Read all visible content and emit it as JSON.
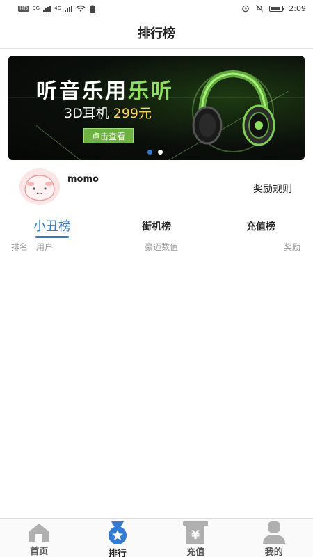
{
  "status_bar": {
    "time": "2:09",
    "net_1": "3G",
    "net_2": "4G",
    "hd": "HD"
  },
  "header": {
    "title": "排行榜"
  },
  "banner": {
    "headline_main": "听音乐用",
    "headline_highlight": "乐听",
    "subtitle": "3D耳机",
    "price": "299元",
    "button": "点击查看",
    "active_slide": 1,
    "slide_count": 2,
    "accent_color": "#8ee05a"
  },
  "user": {
    "name": "momo",
    "rules_link": "奖励规则"
  },
  "tabs": [
    {
      "label": "小丑榜",
      "active": true
    },
    {
      "label": "街机榜",
      "active": false
    },
    {
      "label": "充值榜",
      "active": false
    }
  ],
  "columns": {
    "rank": "排名",
    "user": "用户",
    "value": "豪迈数值",
    "reward": "奖励"
  },
  "bottom_nav": [
    {
      "label": "首页",
      "icon": "home-icon",
      "active": false
    },
    {
      "label": "排行",
      "icon": "medal-icon",
      "active": true
    },
    {
      "label": "充值",
      "icon": "yen-icon",
      "active": false
    },
    {
      "label": "我的",
      "icon": "person-icon",
      "active": false
    }
  ],
  "colors": {
    "accent": "#2f7bd6",
    "icon_gray": "#b0b0b0"
  }
}
